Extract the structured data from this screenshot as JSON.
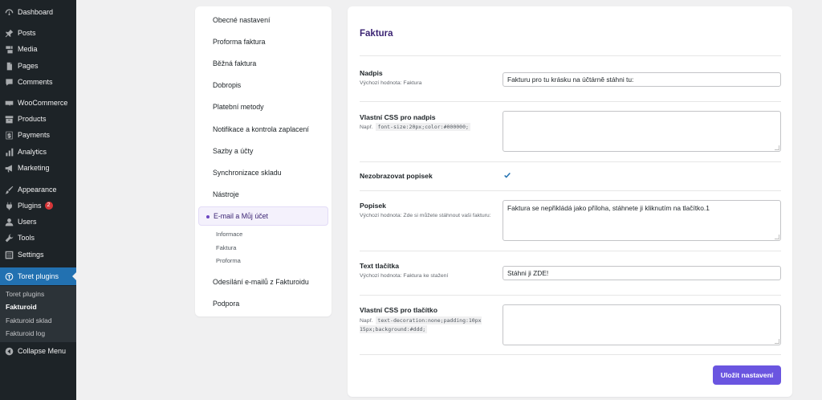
{
  "admin_menu": {
    "items": [
      {
        "label": "Dashboard",
        "icon": "dashboard-icon"
      },
      {
        "label": "Posts",
        "icon": "pin-icon"
      },
      {
        "label": "Media",
        "icon": "media-icon"
      },
      {
        "label": "Pages",
        "icon": "page-icon"
      },
      {
        "label": "Comments",
        "icon": "comment-icon"
      },
      {
        "label": "WooCommerce",
        "icon": "woo-icon"
      },
      {
        "label": "Products",
        "icon": "archive-icon"
      },
      {
        "label": "Payments",
        "icon": "dollar-icon"
      },
      {
        "label": "Analytics",
        "icon": "bar-chart-icon"
      },
      {
        "label": "Marketing",
        "icon": "megaphone-icon"
      },
      {
        "label": "Appearance",
        "icon": "brush-icon"
      },
      {
        "label": "Plugins",
        "icon": "plug-icon",
        "badge": "2"
      },
      {
        "label": "Users",
        "icon": "user-icon"
      },
      {
        "label": "Tools",
        "icon": "wrench-icon"
      },
      {
        "label": "Settings",
        "icon": "sliders-icon"
      },
      {
        "label": "Toret plugins",
        "icon": "toret-icon"
      },
      {
        "label": "Collapse Menu",
        "icon": "collapse-icon"
      }
    ],
    "submenu": [
      "Toret plugins",
      "Fakturoid",
      "Fakturoid sklad",
      "Fakturoid log"
    ]
  },
  "settings_nav": {
    "items": [
      "Obecné nastavení",
      "Proforma faktura",
      "Běžná faktura",
      "Dobropis",
      "Platební metody",
      "Notifikace a kontrola zaplacení",
      "Sazby a účty",
      "Synchronizace skladu",
      "Nástroje",
      "E-mail a Můj účet",
      "Odesílání e-mailů z Fakturoidu",
      "Podpora"
    ],
    "sub_items": [
      "Informace",
      "Faktura",
      "Proforma"
    ]
  },
  "form": {
    "title": "Faktura",
    "nadpis_label": "Nadpis",
    "nadpis_hint": "Výchozí hodnota: Faktura",
    "nadpis_value": "Fakturu pro tu krásku na účtárně stáhni tu:",
    "css_nadpis_label": "Vlastní CSS pro nadpis",
    "css_nadpis_hint_prefix": "Např.",
    "css_nadpis_hint_code": "font-size:20px;color:#000000;",
    "css_nadpis_value": "",
    "hide_desc_label": "Nezobrazovat popisek",
    "hide_desc_checked": true,
    "popisek_label": "Popisek",
    "popisek_hint": "Výchozí hodnota: Zde si můžete stáhnout vaši fakturu:",
    "popisek_value": "Faktura se nepřikládá jako příloha, stáhnete ji kliknutím na tlačítko.1",
    "btn_text_label": "Text tlačítka",
    "btn_text_hint": "Výchozí hodnota: Faktura ke stažení",
    "btn_text_value": "Stáhni ji ZDE!",
    "css_btn_label": "Vlastní CSS pro tlačítko",
    "css_btn_hint_prefix": "Např.",
    "css_btn_hint_code": "text-decoration:none;padding:10px 15px;background:#ddd;",
    "css_btn_value": "",
    "save_label": "Uložit nastavení"
  },
  "colors": {
    "sidebar_bg": "#1d2327",
    "active_menu": "#2271b1",
    "accent_purple": "#6a55e0",
    "title_purple": "#3b2473"
  }
}
